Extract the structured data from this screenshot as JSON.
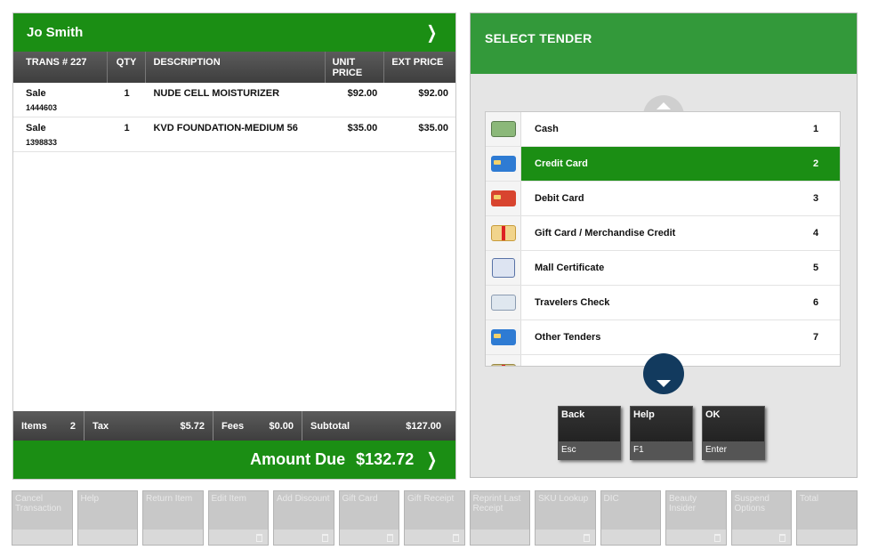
{
  "customer": {
    "name": "Jo Smith"
  },
  "table": {
    "headers": [
      "TRANS # 227",
      "QTY",
      "DESCRIPTION",
      "UNIT PRICE",
      "EXT PRICE"
    ],
    "rows": [
      {
        "type": "Sale",
        "sku": "1444603",
        "qty": "1",
        "desc": "NUDE CELL MOISTURIZER",
        "unit": "$92.00",
        "ext": "$92.00"
      },
      {
        "type": "Sale",
        "sku": "1398833",
        "qty": "1",
        "desc": "KVD FOUNDATION-MEDIUM 56",
        "unit": "$35.00",
        "ext": "$35.00"
      }
    ]
  },
  "totals": {
    "items_label": "Items",
    "items_value": "2",
    "tax_label": "Tax",
    "tax_value": "$5.72",
    "fees_label": "Fees",
    "fees_value": "$0.00",
    "subtotal_label": "Subtotal",
    "subtotal_value": "$127.00"
  },
  "amount_due": {
    "label": "Amount Due",
    "value": "$132.72"
  },
  "tender": {
    "title": "SELECT TENDER",
    "options": [
      {
        "label": "Cash",
        "num": "1",
        "icon": "cash-icon"
      },
      {
        "label": "Credit Card",
        "num": "2",
        "icon": "credit-card-icon",
        "selected": true
      },
      {
        "label": "Debit Card",
        "num": "3",
        "icon": "debit-card-icon"
      },
      {
        "label": "Gift Card / Merchandise Credit",
        "num": "4",
        "icon": "gift-card-icon"
      },
      {
        "label": "Mall Certificate",
        "num": "5",
        "icon": "mall-certificate-icon"
      },
      {
        "label": "Travelers Check",
        "num": "6",
        "icon": "travelers-check-icon"
      },
      {
        "label": "Other Tenders",
        "num": "7",
        "icon": "other-tenders-icon"
      }
    ]
  },
  "keys": [
    {
      "label": "Back",
      "key": "Esc"
    },
    {
      "label": "Help",
      "key": "F1"
    },
    {
      "label": "OK",
      "key": "Enter"
    }
  ],
  "function_bar": [
    {
      "label": "Cancel Transaction",
      "trash": false
    },
    {
      "label": "Help",
      "trash": false
    },
    {
      "label": "Return Item",
      "trash": false
    },
    {
      "label": "Edit Item",
      "trash": true
    },
    {
      "label": "Add Discount",
      "trash": true
    },
    {
      "label": "Gift Card",
      "trash": true
    },
    {
      "label": "Gift Receipt",
      "trash": true
    },
    {
      "label": "Reprint Last Receipt",
      "trash": false
    },
    {
      "label": "SKU Lookup",
      "trash": true
    },
    {
      "label": "DIC",
      "trash": false
    },
    {
      "label": "Beauty Insider",
      "trash": true
    },
    {
      "label": "Suspend Options",
      "trash": true
    },
    {
      "label": "Total",
      "trash": false
    }
  ],
  "colors": {
    "green": "#1b8e14",
    "header_green": "#33993a",
    "dark": "#3e3e3e"
  }
}
